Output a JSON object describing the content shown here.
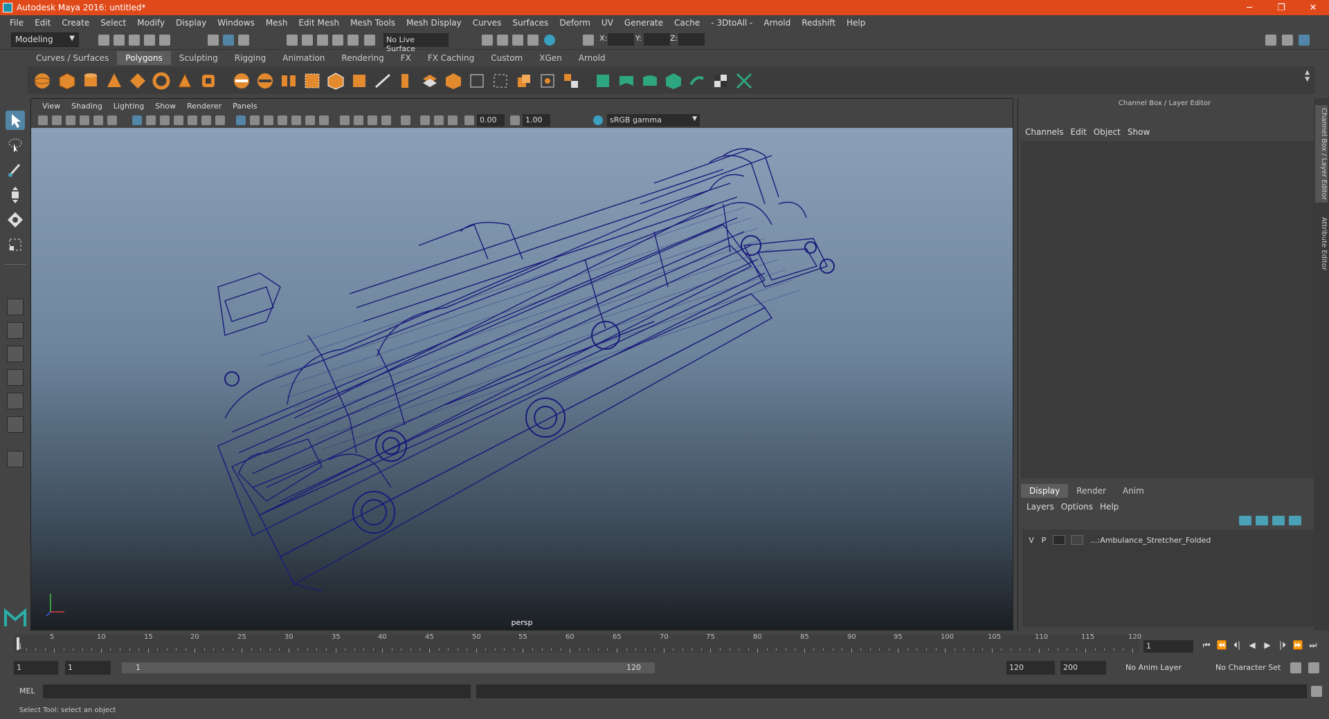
{
  "window": {
    "title": "Autodesk Maya 2016: untitled*",
    "controls": [
      "─",
      "❐",
      "✕"
    ]
  },
  "menubar": [
    "File",
    "Edit",
    "Create",
    "Select",
    "Modify",
    "Display",
    "Windows",
    "Mesh",
    "Edit Mesh",
    "Mesh Tools",
    "Mesh Display",
    "Curves",
    "Surfaces",
    "Deform",
    "UV",
    "Generate",
    "Cache",
    "- 3DtoAll -",
    "Arnold",
    "Redshift",
    "Help"
  ],
  "status_line": {
    "mode": "Modeling",
    "live_surface": "No Live Surface",
    "x_label": "X:",
    "y_label": "Y:",
    "z_label": "Z:"
  },
  "shelf_tabs": [
    "Curves / Surfaces",
    "Polygons",
    "Sculpting",
    "Rigging",
    "Animation",
    "Rendering",
    "FX",
    "FX Caching",
    "Custom",
    "XGen",
    "Arnold"
  ],
  "shelf_active": "Polygons",
  "colors": {
    "title_bar": "#e04a1a",
    "wireframe": "#1a1a7a",
    "accent": "#5285a6",
    "shelf_orange": "#e38a2f",
    "shelf_teal": "#2ea67f"
  },
  "viewport": {
    "menu": [
      "View",
      "Shading",
      "Lighting",
      "Show",
      "Renderer",
      "Panels"
    ],
    "exposure": "0.00",
    "gamma": "1.00",
    "color_space": "sRGB gamma",
    "camera": "persp"
  },
  "channel_box": {
    "title": "Channel Box / Layer Editor",
    "menu": [
      "Channels",
      "Edit",
      "Object",
      "Show"
    ]
  },
  "layer_editor": {
    "tabs": [
      "Display",
      "Render",
      "Anim"
    ],
    "active_tab": "Display",
    "menu": [
      "Layers",
      "Options",
      "Help"
    ],
    "layers": [
      {
        "visible": "V",
        "playback": "P",
        "name": "...:Ambulance_Stretcher_Folded"
      }
    ]
  },
  "side_tabs": [
    "Channel Box / Layer Editor",
    "Attribute Editor"
  ],
  "timeline": {
    "ticks": [
      "5",
      "10",
      "15",
      "20",
      "25",
      "30",
      "35",
      "40",
      "45",
      "50",
      "55",
      "60",
      "65",
      "70",
      "75",
      "80",
      "85",
      "90",
      "95",
      "100",
      "105",
      "110",
      "115",
      "120"
    ],
    "first_tick": "1",
    "current_frame": "1",
    "transport": [
      "⏮",
      "⏪",
      "⏴|",
      "◀",
      "▶",
      "|⏵",
      "⏩",
      "⏭"
    ]
  },
  "range": {
    "start": "1",
    "playback_start": "1",
    "slider_start": "1",
    "slider_end": "120",
    "playback_end": "120",
    "end": "200",
    "anim_layer": "No Anim Layer",
    "character_set": "No Character Set"
  },
  "command_line": {
    "label": "MEL"
  },
  "help_line": "Select Tool: select an object"
}
